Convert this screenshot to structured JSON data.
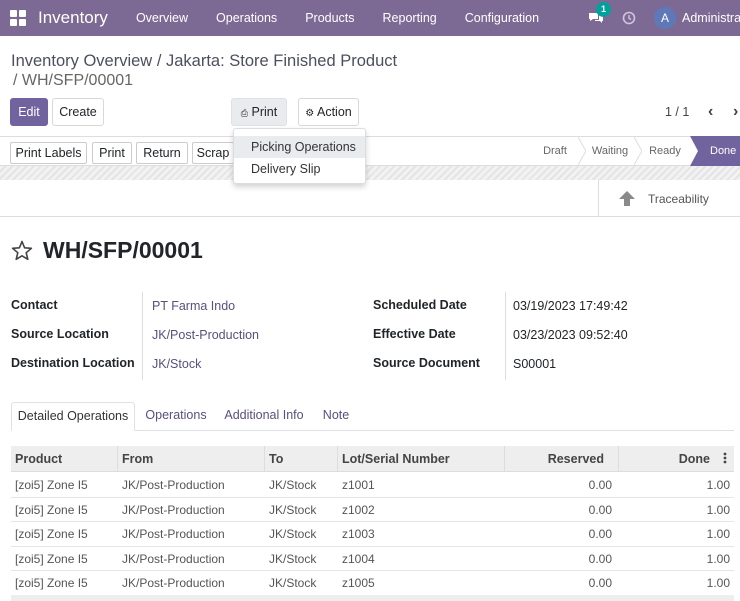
{
  "navbar": {
    "brand": "Inventory",
    "menu": [
      "Overview",
      "Operations",
      "Products",
      "Reporting",
      "Configuration"
    ],
    "chat_badge": "1",
    "avatar_letter": "A",
    "user_name": "Administrator"
  },
  "breadcrumb": {
    "part1": "Inventory Overview",
    "sep1": "/",
    "part2": "Jakarta: Store Finished Product",
    "current": "/ WH/SFP/00001"
  },
  "buttons": {
    "edit": "Edit",
    "create": "Create",
    "print": "Print",
    "action": "Action"
  },
  "pager": {
    "value": "1 / 1"
  },
  "print_menu": {
    "items": [
      "Picking Operations",
      "Delivery Slip"
    ]
  },
  "statusbar": {
    "buttons": [
      "Print Labels",
      "Print",
      "Return",
      "Scrap"
    ],
    "stages": [
      "Draft",
      "Waiting",
      "Ready",
      "Done"
    ],
    "current_stage": "Done"
  },
  "traceability": {
    "label": "Traceability"
  },
  "record": {
    "title": "WH/SFP/00001",
    "left_fields": [
      {
        "label": "Contact",
        "value": "PT Farma Indo"
      },
      {
        "label": "Source Location",
        "value": "JK/Post-Production"
      },
      {
        "label": "Destination Location",
        "value": "JK/Stock"
      }
    ],
    "right_fields": [
      {
        "label": "Scheduled Date",
        "value": "03/19/2023 17:49:42"
      },
      {
        "label": "Effective Date",
        "value": "03/23/2023 09:52:40"
      },
      {
        "label": "Source Document",
        "value": "S00001"
      }
    ]
  },
  "tabs": [
    "Detailed Operations",
    "Operations",
    "Additional Info",
    "Note"
  ],
  "table": {
    "headers": [
      "Product",
      "From",
      "To",
      "Lot/Serial Number",
      "Reserved",
      "Done"
    ],
    "rows": [
      [
        "[zoi5] Zone I5",
        "JK/Post-Production",
        "JK/Stock",
        "z1001",
        "0.00",
        "1.00"
      ],
      [
        "[zoi5] Zone I5",
        "JK/Post-Production",
        "JK/Stock",
        "z1002",
        "0.00",
        "1.00"
      ],
      [
        "[zoi5] Zone I5",
        "JK/Post-Production",
        "JK/Stock",
        "z1003",
        "0.00",
        "1.00"
      ],
      [
        "[zoi5] Zone I5",
        "JK/Post-Production",
        "JK/Stock",
        "z1004",
        "0.00",
        "1.00"
      ],
      [
        "[zoi5] Zone I5",
        "JK/Post-Production",
        "JK/Stock",
        "z1005",
        "0.00",
        "1.00"
      ]
    ]
  },
  "colors": {
    "navbar": "#7c6a94",
    "primary": "#71639e",
    "link": "#5a4f7d",
    "badge": "#00a09d"
  }
}
